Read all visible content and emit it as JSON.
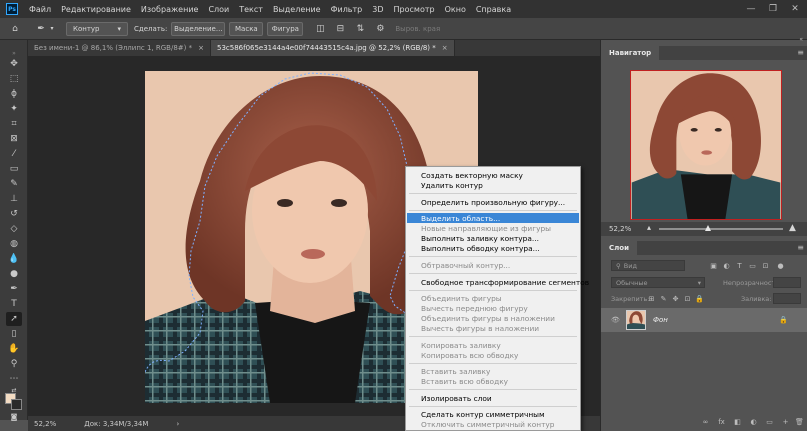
{
  "app": {
    "logo": "Ps",
    "menu": [
      "Файл",
      "Редактирование",
      "Изображение",
      "Слои",
      "Текст",
      "Выделение",
      "Фильтр",
      "3D",
      "Просмотр",
      "Окно",
      "Справка"
    ],
    "window_controls": [
      "—",
      "❐",
      "✕"
    ]
  },
  "options": {
    "mode_value": "Контур",
    "make_label": "Сделать:",
    "selection_btn": "Выделение...",
    "mask_btn": "Маска",
    "shape_btn": "Фигура",
    "align_edges": "Выров. края"
  },
  "tabs": [
    {
      "label": "Без имени-1 @ 86,1% (Эллипс 1, RGB/8#) *",
      "close": "×"
    },
    {
      "label": "53c586f065e3144a4e00f74443515c4a.jpg @ 52,2% (RGB/8) *",
      "close": "×"
    }
  ],
  "status": {
    "zoom": "52,2%",
    "doc": "Док: 3,34M/3,34M",
    "arrow": "›"
  },
  "context_menu": {
    "items": [
      {
        "label": "Создать векторную маску",
        "disabled": false
      },
      {
        "label": "Удалить контур",
        "disabled": false
      },
      {
        "label": "Определить произвольную фигуру...",
        "disabled": false
      },
      {
        "label": "Выделить область...",
        "disabled": false,
        "highlighted": true
      },
      {
        "label": "Новые направляющие из фигуры",
        "disabled": true
      },
      {
        "label": "Выполнить заливку контура...",
        "disabled": false
      },
      {
        "label": "Выполнить обводку контура...",
        "disabled": false
      },
      {
        "label": "Обтравочный контур...",
        "disabled": true
      },
      {
        "label": "Свободное трансформирование сегментов",
        "disabled": false
      },
      {
        "label": "Объединить фигуры",
        "disabled": true
      },
      {
        "label": "Вычесть переднюю фигуру",
        "disabled": true
      },
      {
        "label": "Объединить фигуры в наложении",
        "disabled": true
      },
      {
        "label": "Вычесть фигуры в наложении",
        "disabled": true
      },
      {
        "label": "Копировать заливку",
        "disabled": true
      },
      {
        "label": "Копировать всю обводку",
        "disabled": true
      },
      {
        "label": "Вставить заливку",
        "disabled": true
      },
      {
        "label": "Вставить всю обводку",
        "disabled": true
      },
      {
        "label": "Изолировать слои",
        "disabled": false
      },
      {
        "label": "Сделать контур симметричным",
        "disabled": false
      },
      {
        "label": "Отключить симметричный контур",
        "disabled": true
      }
    ]
  },
  "navigator": {
    "title": "Навигатор",
    "zoom": "52,2%",
    "menu_icon": "≡",
    "collapse": "«"
  },
  "layers": {
    "title": "Слои",
    "menu_icon": "≡",
    "kind_placeholder": "Вид",
    "blend_mode": "Обычные",
    "opacity_label": "Непрозрачность:",
    "lock_label": "Закрепить:",
    "fill_label": "Заливка:",
    "layer_name": "Фон",
    "bottom_icons": [
      "∞",
      "fx",
      "◧",
      "◐",
      "▭",
      "+",
      "🗑"
    ]
  },
  "colors": {
    "accent": "#31a8ff",
    "highlight": "#3a86d6",
    "path": "#7fb0ff"
  }
}
